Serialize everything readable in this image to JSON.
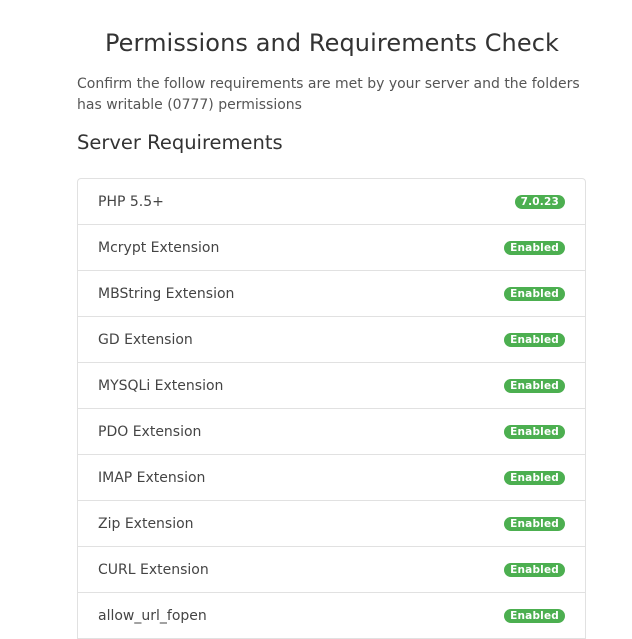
{
  "page": {
    "title": "Permissions and Requirements Check",
    "intro": "Confirm the follow requirements are met by your server and the folders has writable (0777) permissions"
  },
  "server_requirements": {
    "title": "Server Requirements",
    "items": [
      {
        "name": "PHP 5.5+",
        "status": "7.0.23"
      },
      {
        "name": "Mcrypt Extension",
        "status": "Enabled"
      },
      {
        "name": "MBString Extension",
        "status": "Enabled"
      },
      {
        "name": "GD Extension",
        "status": "Enabled"
      },
      {
        "name": "MYSQLi Extension",
        "status": "Enabled"
      },
      {
        "name": "PDO Extension",
        "status": "Enabled"
      },
      {
        "name": "IMAP Extension",
        "status": "Enabled"
      },
      {
        "name": "Zip Extension",
        "status": "Enabled"
      },
      {
        "name": "CURL Extension",
        "status": "Enabled"
      },
      {
        "name": "allow_url_fopen",
        "status": "Enabled"
      }
    ]
  },
  "colors": {
    "badge_success": "#4caf50"
  }
}
